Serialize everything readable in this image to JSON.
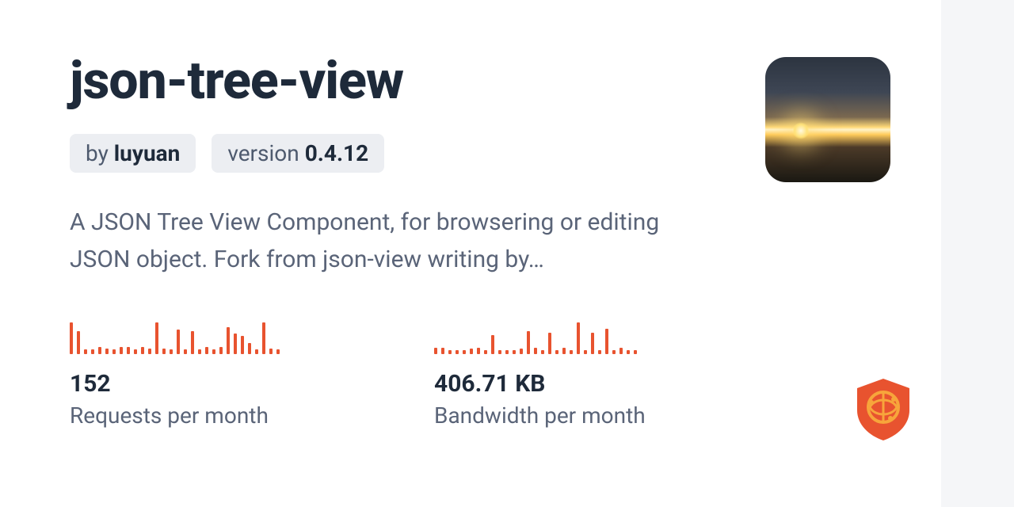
{
  "package": {
    "name": "json-tree-view",
    "by_prefix": "by ",
    "author": "luyuan",
    "version_prefix": "version ",
    "version": "0.4.12",
    "description": "A JSON Tree View Component, for browsering or editing JSON object. Fork from json-view writing by…"
  },
  "stats": {
    "requests": {
      "value": "152",
      "label": "Requests per month"
    },
    "bandwidth": {
      "value": "406.71 KB",
      "label": "Bandwidth per month"
    }
  },
  "chart_data": [
    {
      "type": "bar",
      "title": "Requests sparkline",
      "values": [
        28,
        20,
        4,
        4,
        6,
        5,
        4,
        6,
        6,
        4,
        6,
        5,
        28,
        5,
        4,
        22,
        4,
        20,
        4,
        6,
        4,
        6,
        24,
        18,
        16,
        10,
        4,
        28,
        5,
        4
      ]
    },
    {
      "type": "bar",
      "title": "Bandwidth sparkline",
      "values": [
        6,
        6,
        4,
        4,
        4,
        5,
        6,
        4,
        18,
        4,
        4,
        4,
        5,
        22,
        6,
        4,
        20,
        4,
        6,
        4,
        30,
        4,
        20,
        4,
        24,
        4,
        6,
        4,
        4
      ]
    }
  ],
  "colors": {
    "accent": "#e8532f"
  }
}
